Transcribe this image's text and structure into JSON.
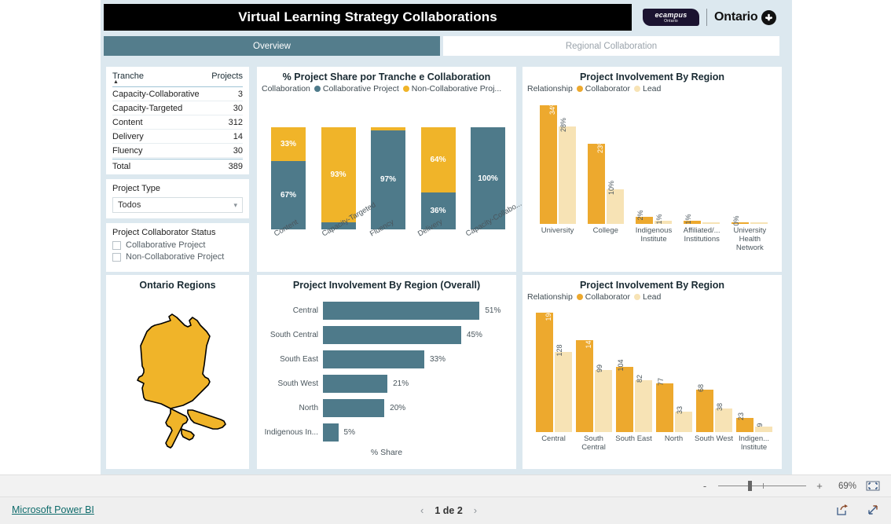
{
  "header": {
    "title": "Virtual Learning Strategy Collaborations",
    "ecampus_logo_line1": "ecampus",
    "ecampus_logo_line2": "Ontario",
    "ontario_logo_text": "Ontario",
    "trillium_icon": "trillium-icon"
  },
  "tabs": [
    {
      "label": "Overview",
      "active": true
    },
    {
      "label": "Regional Collaboration",
      "active": false
    }
  ],
  "tranche_table": {
    "col_tranche": "Tranche",
    "col_projects": "Projects",
    "rows": [
      {
        "name": "Capacity-Collaborative",
        "value": "3"
      },
      {
        "name": "Capacity-Targeted",
        "value": "30"
      },
      {
        "name": "Content",
        "value": "312"
      },
      {
        "name": "Delivery",
        "value": "14"
      },
      {
        "name": "Fluency",
        "value": "30"
      }
    ],
    "total_label": "Total",
    "total_value": "389"
  },
  "project_type": {
    "label": "Project Type",
    "value": "Todos",
    "chevron_icon": "chevron-down-icon"
  },
  "collaborator_status": {
    "title": "Project Collaborator Status",
    "options": [
      {
        "label": "Collaborative Project",
        "checked": false
      },
      {
        "label": "Non-Collaborative Project",
        "checked": false
      }
    ]
  },
  "map_panel": {
    "title": "Ontario Regions",
    "fill_color": "#F0B429",
    "stroke_color": "#000000"
  },
  "colors": {
    "teal": "#4E7A8A",
    "amber": "#F0B429",
    "collaborator": "#EDA92E",
    "lead": "#F7E3B5",
    "canvas": "#DCE8EF",
    "tab_active": "#547D8C"
  },
  "chart_data": [
    {
      "id": "stacked",
      "type": "bar",
      "title": "% Project Share por Tranche e Collaboration",
      "legend_title": "Collaboration",
      "legend_position": "top",
      "stacked": true,
      "categories": [
        "Content",
        "Capacity-Targeted",
        "Fluency",
        "Delivery",
        "Capacity-Collabo..."
      ],
      "series": [
        {
          "name": "Collaborative Project",
          "color": "#4E7A8A",
          "values": [
            67,
            7,
            97,
            36,
            100
          ],
          "labels": [
            "67%",
            "",
            "97%",
            "36%",
            "100%"
          ]
        },
        {
          "name": "Non-Collaborative Proj...",
          "color": "#F0B429",
          "values": [
            33,
            93,
            3,
            64,
            0
          ],
          "labels": [
            "33%",
            "93%",
            "",
            "64%",
            ""
          ]
        }
      ],
      "ylim": [
        0,
        100
      ],
      "xlabel": "",
      "ylabel": ""
    },
    {
      "id": "involvement_pct",
      "type": "bar",
      "title": "Project Involvement By Region",
      "legend_title": "Relationship",
      "legend_position": "top",
      "categories": [
        "University",
        "College",
        "Indigenous Institute",
        "Affiliated/... Institutions",
        "University Health Network"
      ],
      "series": [
        {
          "name": "Collaborator",
          "color": "#EDA92E",
          "values": [
            34,
            23,
            2,
            1,
            0
          ],
          "labels": [
            "34%",
            "23%",
            "2%",
            "1%",
            "0%"
          ]
        },
        {
          "name": "Lead",
          "color": "#F7E3B5",
          "values": [
            28,
            10,
            1,
            0,
            0
          ],
          "labels": [
            "28%",
            "10%",
            "1%",
            "",
            ""
          ]
        }
      ],
      "ylim": [
        0,
        36
      ],
      "xlabel": "",
      "ylabel": ""
    },
    {
      "id": "involvement_overall",
      "type": "bar",
      "orientation": "horizontal",
      "title": "Project Involvement By Region (Overall)",
      "categories": [
        "Central",
        "South Central",
        "South East",
        "South West",
        "North",
        "Indigenous In..."
      ],
      "values": [
        51,
        45,
        33,
        21,
        20,
        5
      ],
      "labels": [
        "51%",
        "45%",
        "33%",
        "21%",
        "20%",
        "5%"
      ],
      "color": "#4E7A8A",
      "xlabel": "% Share",
      "ylabel": "",
      "xlim": [
        0,
        55
      ]
    },
    {
      "id": "involvement_counts",
      "type": "bar",
      "title": "Project Involvement By Region",
      "legend_title": "Relationship",
      "legend_position": "top",
      "categories": [
        "Central",
        "South Central",
        "South East",
        "North",
        "South West",
        "Indigen... Institute"
      ],
      "series": [
        {
          "name": "Collaborator",
          "color": "#EDA92E",
          "values": [
            190,
            146,
            104,
            77,
            68,
            23
          ],
          "labels": [
            "190",
            "146",
            "104",
            "77",
            "68",
            "23"
          ]
        },
        {
          "name": "Lead",
          "color": "#F7E3B5",
          "values": [
            128,
            99,
            82,
            33,
            38,
            9
          ],
          "labels": [
            "128",
            "99",
            "82",
            "33",
            "38",
            "9"
          ]
        }
      ],
      "ylim": [
        0,
        200
      ],
      "xlabel": "",
      "ylabel": ""
    }
  ],
  "zoom_bar": {
    "minus": "-",
    "plus": "+",
    "percent": "69%",
    "fit_icon": "fit-to-page-icon"
  },
  "status_bar": {
    "powerbi_link": "Microsoft Power BI",
    "prev_icon": "chevron-left-icon",
    "next_icon": "chevron-right-icon",
    "page_text": "1 de 2",
    "share_icon": "share-icon",
    "fullscreen_icon": "fullscreen-icon"
  }
}
